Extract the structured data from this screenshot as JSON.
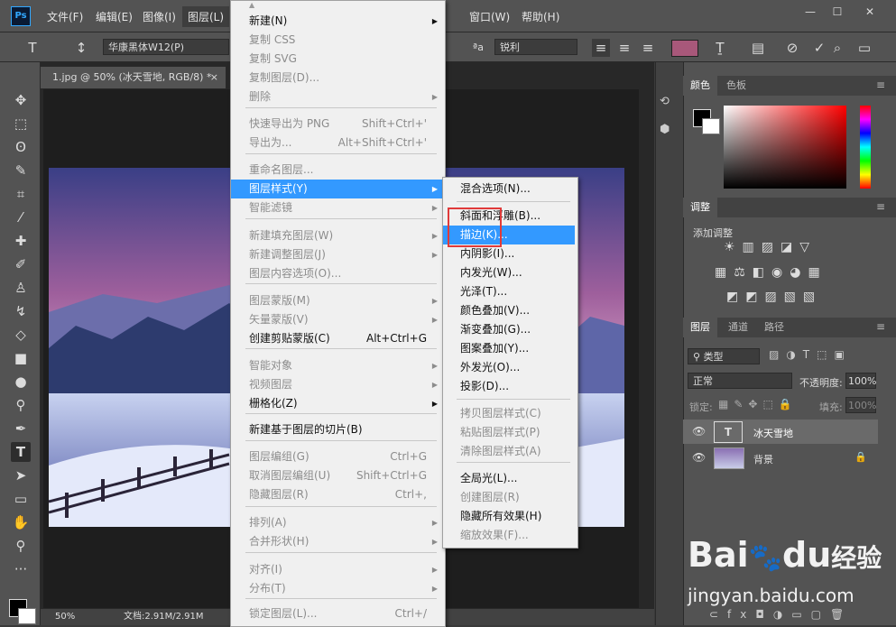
{
  "app": {
    "logo": "Ps",
    "menus": [
      "文件(F)",
      "编辑(E)",
      "图像(I)",
      "图层(L)",
      "窗口(W)",
      "帮助(H)"
    ],
    "window_buttons": [
      "—",
      "☐",
      "✕"
    ]
  },
  "options": {
    "font_family": "华康黑体W12(P)",
    "antialias": "锐利",
    "text_color": "#a8587a"
  },
  "document": {
    "tab_title": "1.jpg @ 50% (冰天雪地, RGB/8) *",
    "tab_close": "×",
    "zoom": "50%",
    "doc_size": "文档:2.91M/2.91M"
  },
  "panels": {
    "color_tabs": [
      "颜色",
      "色板"
    ],
    "adjust_tab": "调整",
    "adjust_add": "添加调整",
    "layers_tabs": [
      "图层",
      "通道",
      "路径"
    ],
    "layer_filter": "类型",
    "blend_mode": "正常",
    "opacity_label": "不透明度:",
    "opacity_value": "100%",
    "lock_label": "锁定:",
    "fill_label": "填充:",
    "fill_value": "100%",
    "layers": [
      {
        "name": "冰天雪地",
        "type": "text"
      },
      {
        "name": "背景",
        "type": "image"
      }
    ]
  },
  "layer_menu": {
    "items": [
      {
        "label": "新建(N)",
        "shortcut": "",
        "submenu": true,
        "disabled": false
      },
      {
        "label": "复制 CSS",
        "shortcut": "",
        "submenu": false,
        "disabled": true
      },
      {
        "label": "复制 SVG",
        "shortcut": "",
        "submenu": false,
        "disabled": true
      },
      {
        "label": "复制图层(D)...",
        "shortcut": "",
        "submenu": false,
        "disabled": true
      },
      {
        "label": "删除",
        "shortcut": "",
        "submenu": true,
        "disabled": true
      },
      {
        "label": "快速导出为 PNG",
        "shortcut": "Shift+Ctrl+'",
        "submenu": false,
        "disabled": true
      },
      {
        "label": "导出为...",
        "shortcut": "Alt+Shift+Ctrl+'",
        "submenu": false,
        "disabled": true
      },
      {
        "label": "重命名图层...",
        "shortcut": "",
        "submenu": false,
        "disabled": true
      },
      {
        "label": "图层样式(Y)",
        "shortcut": "",
        "submenu": true,
        "disabled": false,
        "highlighted": true
      },
      {
        "label": "智能滤镜",
        "shortcut": "",
        "submenu": true,
        "disabled": true
      },
      {
        "label": "新建填充图层(W)",
        "shortcut": "",
        "submenu": true,
        "disabled": true
      },
      {
        "label": "新建调整图层(J)",
        "shortcut": "",
        "submenu": true,
        "disabled": true
      },
      {
        "label": "图层内容选项(O)...",
        "shortcut": "",
        "submenu": false,
        "disabled": true
      },
      {
        "label": "图层蒙版(M)",
        "shortcut": "",
        "submenu": true,
        "disabled": true
      },
      {
        "label": "矢量蒙版(V)",
        "shortcut": "",
        "submenu": true,
        "disabled": true
      },
      {
        "label": "创建剪贴蒙版(C)",
        "shortcut": "Alt+Ctrl+G",
        "submenu": false,
        "disabled": false
      },
      {
        "label": "智能对象",
        "shortcut": "",
        "submenu": true,
        "disabled": true
      },
      {
        "label": "视频图层",
        "shortcut": "",
        "submenu": true,
        "disabled": true
      },
      {
        "label": "栅格化(Z)",
        "shortcut": "",
        "submenu": true,
        "disabled": false
      },
      {
        "label": "新建基于图层的切片(B)",
        "shortcut": "",
        "submenu": false,
        "disabled": false
      },
      {
        "label": "图层编组(G)",
        "shortcut": "Ctrl+G",
        "submenu": false,
        "disabled": true
      },
      {
        "label": "取消图层编组(U)",
        "shortcut": "Shift+Ctrl+G",
        "submenu": false,
        "disabled": true
      },
      {
        "label": "隐藏图层(R)",
        "shortcut": "Ctrl+,",
        "submenu": false,
        "disabled": true
      },
      {
        "label": "排列(A)",
        "shortcut": "",
        "submenu": true,
        "disabled": true
      },
      {
        "label": "合并形状(H)",
        "shortcut": "",
        "submenu": true,
        "disabled": true
      },
      {
        "label": "对齐(I)",
        "shortcut": "",
        "submenu": true,
        "disabled": true
      },
      {
        "label": "分布(T)",
        "shortcut": "",
        "submenu": true,
        "disabled": true
      },
      {
        "label": "锁定图层(L)...",
        "shortcut": "Ctrl+/",
        "submenu": false,
        "disabled": true
      }
    ]
  },
  "style_menu": {
    "items": [
      {
        "label": "混合选项(N)...",
        "disabled": false
      },
      {
        "label": "斜面和浮雕(B)...",
        "disabled": false
      },
      {
        "label": "描边(K)...",
        "disabled": false,
        "highlighted": true
      },
      {
        "label": "内阴影(I)...",
        "disabled": false
      },
      {
        "label": "内发光(W)...",
        "disabled": false
      },
      {
        "label": "光泽(T)...",
        "disabled": false
      },
      {
        "label": "颜色叠加(V)...",
        "disabled": false
      },
      {
        "label": "渐变叠加(G)...",
        "disabled": false
      },
      {
        "label": "图案叠加(Y)...",
        "disabled": false
      },
      {
        "label": "外发光(O)...",
        "disabled": false
      },
      {
        "label": "投影(D)...",
        "disabled": false
      },
      {
        "label": "拷贝图层样式(C)",
        "disabled": true
      },
      {
        "label": "粘贴图层样式(P)",
        "disabled": true
      },
      {
        "label": "清除图层样式(A)",
        "disabled": true
      },
      {
        "label": "全局光(L)...",
        "disabled": false
      },
      {
        "label": "创建图层(R)",
        "disabled": true
      },
      {
        "label": "隐藏所有效果(H)",
        "disabled": false
      },
      {
        "label": "缩放效果(F)...",
        "disabled": true
      }
    ]
  },
  "watermark": {
    "brand_a": "Bai",
    "brand_b": "du",
    "brand_c": "经验",
    "url": "jingyan.baidu.com"
  }
}
